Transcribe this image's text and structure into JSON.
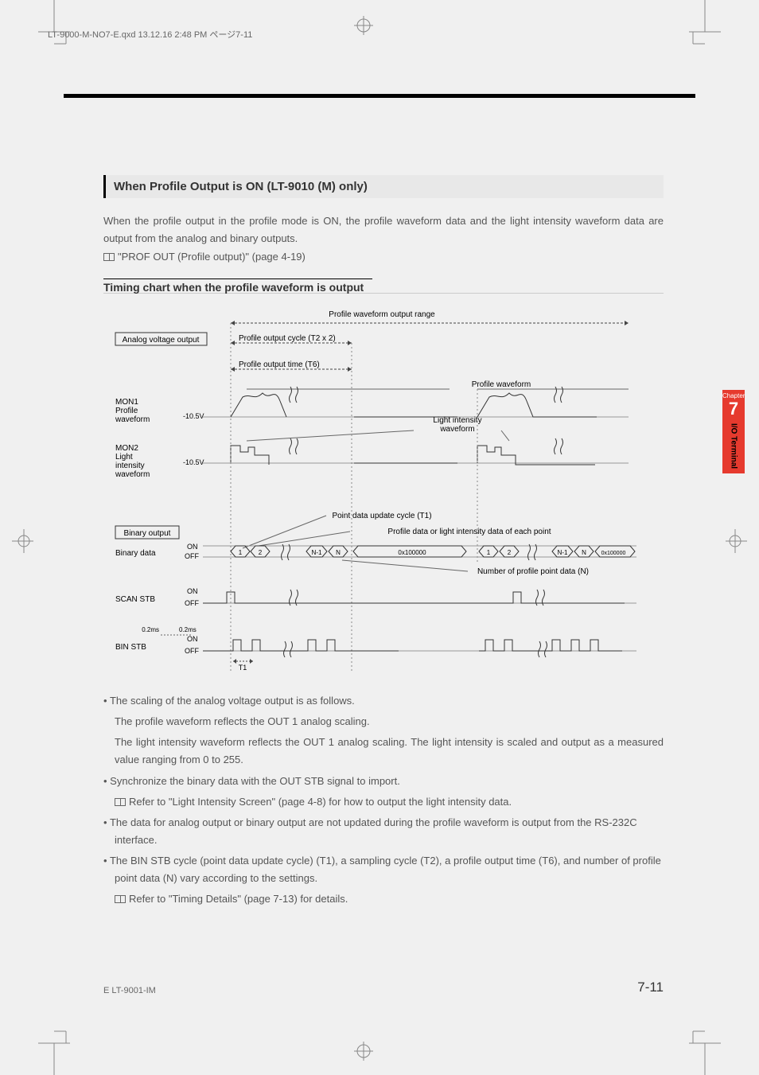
{
  "header": {
    "file_info": "LT-9000-M-NO7-E.qxd  13.12.16  2:48 PM  ページ7-11"
  },
  "section": {
    "title": "When Profile Output is ON (LT-9010 (M) only)",
    "intro": "When the profile output in the profile mode is ON, the profile waveform data and the light intensity waveform data are output from the analog and binary outputs.",
    "ref1": "\"PROF OUT (Profile output)\" (page 4-19)"
  },
  "subsection": {
    "title": "Timing chart when the profile waveform is output"
  },
  "diagram": {
    "top_label": "Profile waveform output range",
    "analog_box": "Analog voltage output",
    "cycle_label": "Profile output cycle (T2 x 2)",
    "time_label": "Profile output time (T6)",
    "profile_wave": "Profile waveform",
    "mon1": "MON1\nProfile\nwaveform",
    "mon1_v": "-10.5V",
    "light_wave": "Light intensity\nwaveform",
    "mon2": "MON2\nLight\nintensity\nwaveform",
    "mon2_v": "-10.5V",
    "point_update": "Point data update cycle (T1)",
    "binary_box": "Binary output",
    "profile_data_label": "Profile data or light intensity data of each point",
    "binary_data": "Binary data",
    "on": "ON",
    "off": "OFF",
    "seq1": "1",
    "seq2": "2",
    "seqNm1": "N-1",
    "seqN": "N",
    "hex": "0x100000",
    "num_points": "Number of profile point data (N)",
    "scan_stb": "SCAN STB",
    "bin_stb": "BIN STB",
    "pulse1": "0.2ms",
    "pulse2": "0.2ms",
    "t1": "T1"
  },
  "bullets": {
    "b1": "The scaling of the analog voltage output is as follows.",
    "b1a": "The profile waveform reflects the OUT 1 analog scaling.",
    "b1b": "The light intensity waveform reflects the OUT 1 analog scaling. The light intensity is scaled and output as a measured value ranging from 0 to 255.",
    "b2": "Synchronize the binary data with the OUT STB signal to import.",
    "b2ref": "Refer to \"Light Intensity Screen\" (page 4-8) for how to output the light intensity data.",
    "b3": "The data for analog output or binary output are not updated during the profile waveform is output from the RS-232C interface.",
    "b4": "The BIN STB cycle (point data update cycle) (T1), a sampling cycle (T2), a profile output time (T6), and number of profile point data (N) vary according to the settings.",
    "b4ref": "Refer to \"Timing Details\" (page 7-13) for details."
  },
  "chapter_tab": {
    "label": "Chapter",
    "number": "7",
    "name": "I/O Terminal"
  },
  "footer": {
    "doc_id": "E LT-9001-IM",
    "page": "7-11"
  }
}
